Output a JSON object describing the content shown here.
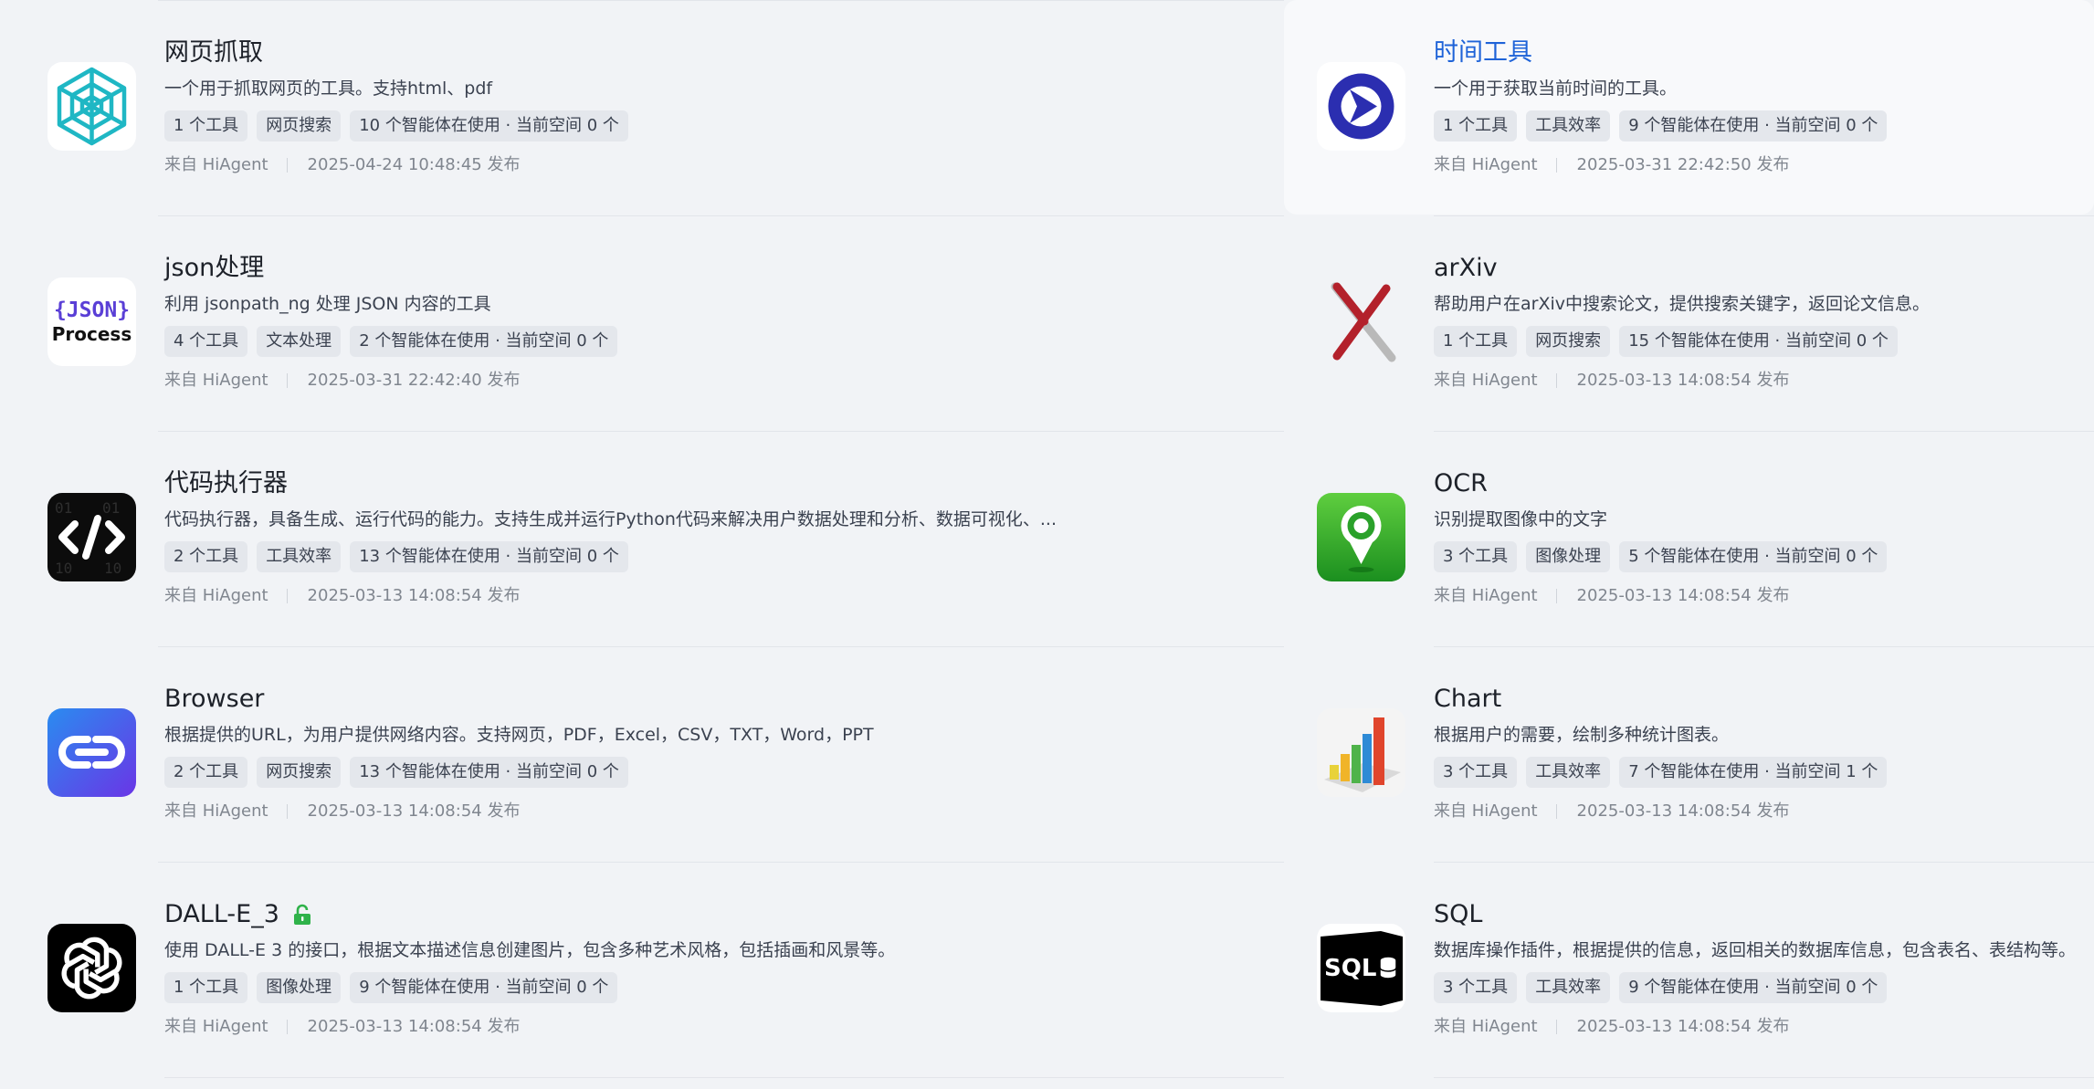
{
  "plugins": [
    {
      "title": "网页抓取",
      "description": "一个用于抓取网页的工具。支持html、pdf",
      "tags": [
        "1 个工具",
        "网页搜索",
        "10 个智能体在使用 · 当前空间 0 个"
      ],
      "source": "来自 HiAgent",
      "published": "2025-04-24 10:48:45 发布",
      "icon": "web-spider-icon"
    },
    {
      "title": "时间工具",
      "description": "一个用于获取当前时间的工具。",
      "tags": [
        "1 个工具",
        "工具效率",
        "9 个智能体在使用 · 当前空间 0 个"
      ],
      "source": "来自 HiAgent",
      "published": "2025-03-31 22:42:50 发布",
      "icon": "time-tool-icon",
      "highlighted": true
    },
    {
      "title": "json处理",
      "description": "利用 jsonpath_ng 处理 JSON 内容的工具",
      "tags": [
        "4 个工具",
        "文本处理",
        "2 个智能体在使用 · 当前空间 0 个"
      ],
      "source": "来自 HiAgent",
      "published": "2025-03-31 22:42:40 发布",
      "icon": "json-process-icon",
      "icon_text_1": "{JSON}",
      "icon_text_2": "Process"
    },
    {
      "title": "arXiv",
      "description": "帮助用户在arXiv中搜索论文，提供搜索关键字，返回论文信息。",
      "tags": [
        "1 个工具",
        "网页搜索",
        "15 个智能体在使用 · 当前空间 0 个"
      ],
      "source": "来自 HiAgent",
      "published": "2025-03-13 14:08:54 发布",
      "icon": "arxiv-icon"
    },
    {
      "title": "代码执行器",
      "description": "代码执行器，具备生成、运行代码的能力。支持生成并运行Python代码来解决用户数据处理和分析、数据可视化、...",
      "tags": [
        "2 个工具",
        "工具效率",
        "13 个智能体在使用 · 当前空间 0 个"
      ],
      "source": "来自 HiAgent",
      "published": "2025-03-13 14:08:54 发布",
      "icon": "code-executor-icon"
    },
    {
      "title": "OCR",
      "description": "识别提取图像中的文字",
      "tags": [
        "3 个工具",
        "图像处理",
        "5 个智能体在使用 · 当前空间 0 个"
      ],
      "source": "来自 HiAgent",
      "published": "2025-03-13 14:08:54 发布",
      "icon": "ocr-pin-icon"
    },
    {
      "title": "Browser",
      "description": "根据提供的URL，为用户提供网络内容。支持网页，PDF，Excel，CSV，TXT，Word，PPT",
      "tags": [
        "2 个工具",
        "网页搜索",
        "13 个智能体在使用 · 当前空间 0 个"
      ],
      "source": "来自 HiAgent",
      "published": "2025-03-13 14:08:54 发布",
      "icon": "browser-link-icon"
    },
    {
      "title": "Chart",
      "description": "根据用户的需要，绘制多种统计图表。",
      "tags": [
        "3 个工具",
        "工具效率",
        "7 个智能体在使用 · 当前空间 1 个"
      ],
      "source": "来自 HiAgent",
      "published": "2025-03-13 14:08:54 发布",
      "icon": "bar-chart-icon"
    },
    {
      "title": "DALL-E_3",
      "description": "使用 DALL-E 3 的接口，根据文本描述信息创建图片，包含多种艺术风格，包括插画和风景等。",
      "tags": [
        "1 个工具",
        "图像处理",
        "9 个智能体在使用 · 当前空间 0 个"
      ],
      "source": "来自 HiAgent",
      "published": "2025-03-13 14:08:54 发布",
      "icon": "openai-icon",
      "badge_icon": "unlock-icon"
    },
    {
      "title": "SQL",
      "description": "数据库操作插件，根据提供的信息，返回相关的数据库信息，包含表名、表结构等。",
      "tags": [
        "3 个工具",
        "工具效率",
        "9 个智能体在使用 · 当前空间 0 个"
      ],
      "source": "来自 HiAgent",
      "published": "2025-03-13 14:08:54 发布",
      "icon": "sql-database-icon",
      "icon_text_1": "SQL"
    }
  ],
  "colors": {
    "title_active": "#1e63d8",
    "background": "#f1f3f6",
    "tag_bg": "#e4e7ec",
    "meta_text": "#80868f"
  }
}
